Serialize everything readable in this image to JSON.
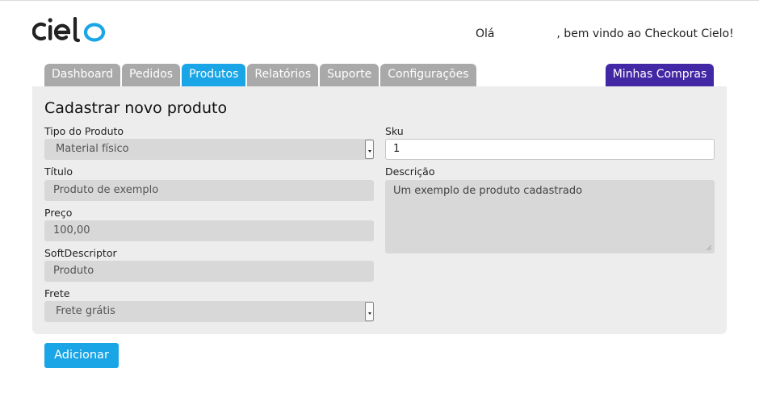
{
  "header": {
    "logo_text": "cielo",
    "greeting_prefix": "Olá",
    "user_name": "",
    "greeting_suffix": ", bem vindo ao Checkout Cielo!"
  },
  "nav": {
    "tabs": [
      {
        "label": "Dashboard",
        "active": false
      },
      {
        "label": "Pedidos",
        "active": false
      },
      {
        "label": "Produtos",
        "active": true
      },
      {
        "label": "Relatórios",
        "active": false
      },
      {
        "label": "Suporte",
        "active": false
      },
      {
        "label": "Configurações",
        "active": false
      }
    ],
    "right_tab": "Minhas Compras"
  },
  "form": {
    "title": "Cadastrar novo produto",
    "product_type": {
      "label": "Tipo do Produto",
      "value": "Material físico"
    },
    "title_field": {
      "label": "Título",
      "value": "Produto de exemplo"
    },
    "price": {
      "label": "Preço",
      "value": "100,00"
    },
    "soft_descriptor": {
      "label": "SoftDescriptor",
      "value": "Produto"
    },
    "shipping": {
      "label": "Frete",
      "value": "Frete grátis"
    },
    "sku": {
      "label": "Sku",
      "value": "1"
    },
    "description": {
      "label": "Descrição",
      "value": "Um exemplo de produto cadastrado"
    },
    "submit_label": "Adicionar"
  },
  "colors": {
    "accent": "#1aa5e6",
    "tab_inactive": "#a9a9a9",
    "purchases_tab": "#4328a5",
    "panel_bg": "#ededed",
    "logo_dark": "#222222",
    "logo_blue": "#1aa5e6"
  }
}
